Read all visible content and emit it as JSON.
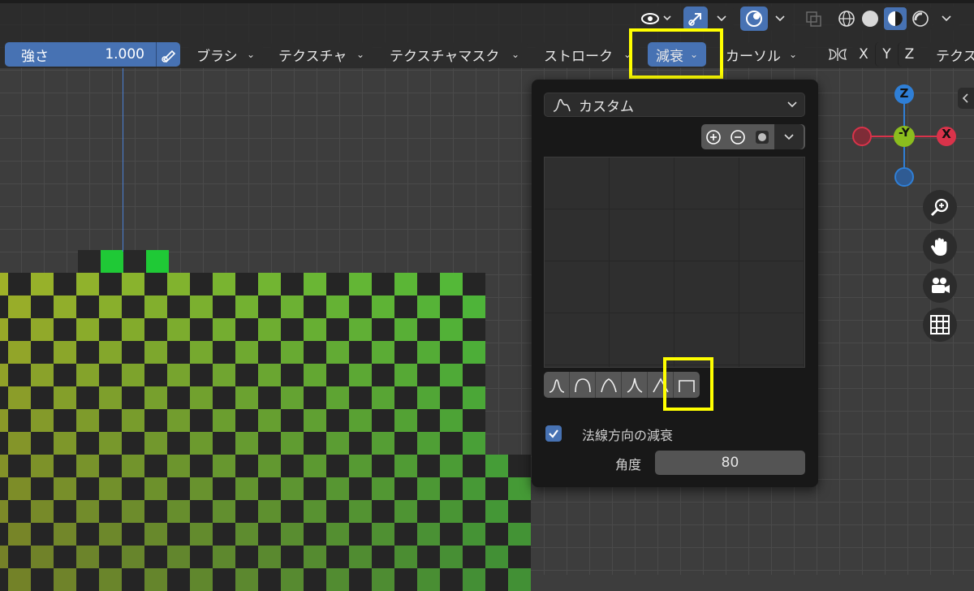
{
  "header": {
    "strength_label": "強さ",
    "strength_value": "1.000",
    "menus": {
      "brush": "ブラシ",
      "texture": "テクスチャ",
      "texture_mask": "テクスチャマスク",
      "stroke": "ストローク",
      "falloff": "減衰",
      "cursor": "カーソル",
      "texture_cut": "テクス"
    },
    "axes": {
      "x": "X",
      "y": "Y",
      "z": "Z"
    }
  },
  "falloff_popup": {
    "type_label": "カスタム",
    "normal_falloff_label": "法線方向の減衰",
    "normal_falloff_checked": true,
    "angle_label": "角度",
    "angle_value": "80",
    "presets": [
      "smooth",
      "sphere",
      "root",
      "sharp",
      "linear",
      "constant"
    ]
  },
  "gizmo": {
    "z": "Z",
    "neg_y": "-Y",
    "x": "X"
  },
  "colors": {
    "accent_blue": "#4772b3",
    "highlight": "#ffff00",
    "axis_x": "#d9334a",
    "axis_y": "#8bbd1e",
    "axis_z": "#2f7fd6"
  }
}
